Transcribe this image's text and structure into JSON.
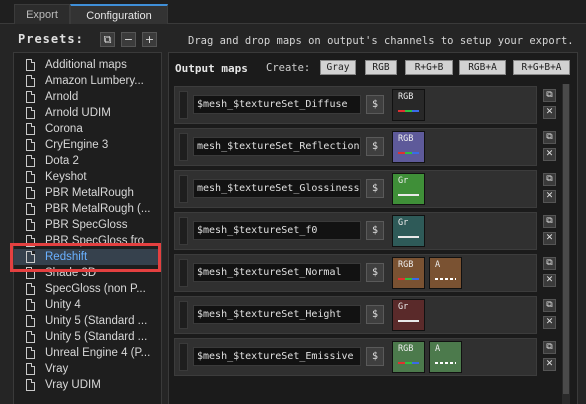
{
  "tabs": [
    {
      "label": "Export"
    },
    {
      "label": "Configuration"
    }
  ],
  "presets": {
    "header": "Presets:",
    "items": [
      "Additional maps",
      "Amazon Lumbery...",
      "Arnold",
      "Arnold UDIM",
      "Corona",
      "CryEngine 3",
      "Dota 2",
      "Keyshot",
      "PBR MetalRough",
      "PBR MetalRough (...",
      "PBR SpecGloss",
      "PBR SpecGloss fro",
      "Redshift",
      "Shade 3D",
      "SpecGloss (non P...",
      "Unity 4",
      "Unity 5 (Standard ...",
      "Unity 5 (Standard ...",
      "Unreal Engine 4 (P...",
      "Vray",
      "Vray UDIM"
    ],
    "selected": "Redshift"
  },
  "hint": "Drag and drop maps on output's channels to setup your export.",
  "output": {
    "title": "Output maps",
    "create_label": "Create:",
    "create_buttons": [
      "Gray",
      "RGB",
      "R+G+B",
      "RGB+A",
      "R+G+B+A"
    ]
  },
  "maps": [
    {
      "name": "$mesh_$textureSet_Diffuse",
      "dollar": "$",
      "chips": [
        {
          "label": "RGB",
          "color": "#282828",
          "line": "rgb"
        }
      ]
    },
    {
      "name": "mesh_$textureSet_Reflection",
      "dollar": "$",
      "chips": [
        {
          "label": "RGB",
          "color": "#5e5a9a",
          "line": "rgb"
        }
      ]
    },
    {
      "name": "mesh_$textureSet_Glossiness",
      "dollar": "$",
      "chips": [
        {
          "label": "Gr",
          "color": "#3f8f38",
          "line": "white"
        }
      ]
    },
    {
      "name": "$mesh_$textureSet_f0",
      "dollar": "$",
      "chips": [
        {
          "label": "Gr",
          "color": "#2e5a58",
          "line": "white"
        }
      ]
    },
    {
      "name": "$mesh_$textureSet_Normal",
      "dollar": "$",
      "chips": [
        {
          "label": "RGB",
          "color": "#7a5232",
          "line": "rgb"
        },
        {
          "label": "A",
          "color": "#7a5232",
          "line": "dash"
        }
      ]
    },
    {
      "name": "$mesh_$textureSet_Height",
      "dollar": "$",
      "chips": [
        {
          "label": "Gr",
          "color": "#5a2a2a",
          "line": "white"
        }
      ]
    },
    {
      "name": "$mesh_$textureSet_Emissive",
      "dollar": "$",
      "chips": [
        {
          "label": "RGB",
          "color": "#4c7a4c",
          "line": "rgb"
        },
        {
          "label": "A",
          "color": "#4c7a4c",
          "line": "dash"
        }
      ]
    }
  ],
  "icons": {
    "copy": "⧉",
    "remove": "−",
    "add": "+",
    "delete": "✕"
  }
}
